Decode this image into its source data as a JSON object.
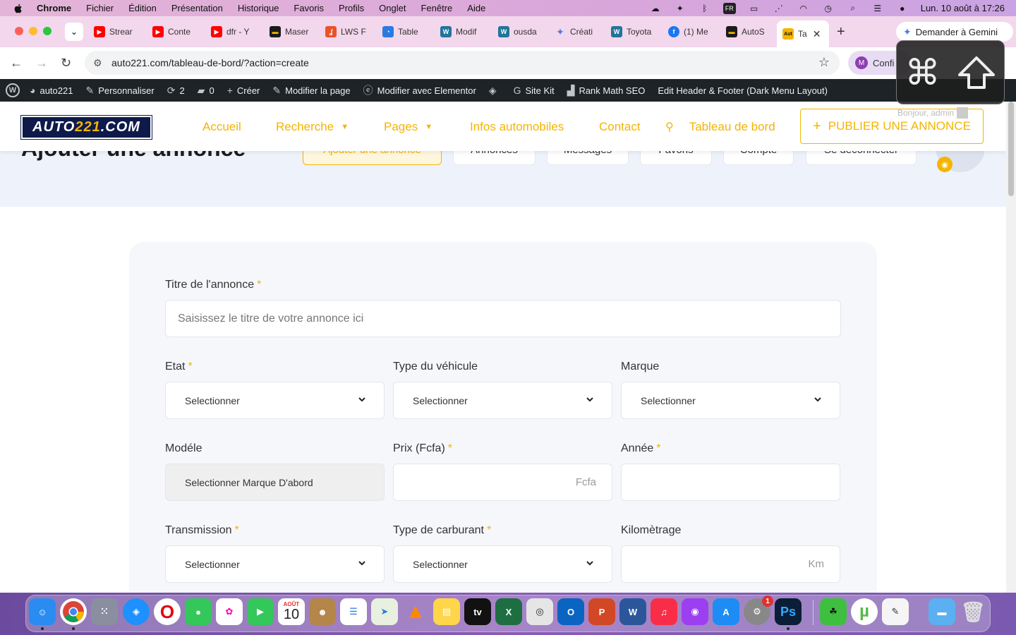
{
  "menubar": {
    "app": "Chrome",
    "items": [
      "Fichier",
      "Édition",
      "Présentation",
      "Historique",
      "Favoris",
      "Profils",
      "Onglet",
      "Fenêtre",
      "Aide"
    ],
    "input_source": "FR",
    "clock": "Lun. 10 août à 17:26"
  },
  "tabs": [
    {
      "label": "Strear",
      "favicon_color": "#ff0000"
    },
    {
      "label": "Conte",
      "favicon_color": "#ff0000"
    },
    {
      "label": "dfr - Y",
      "favicon_color": "#ff0000"
    },
    {
      "label": "Maser",
      "favicon_color": "#1b1b1b"
    },
    {
      "label": "LWS F",
      "favicon_color": "#e9532a"
    },
    {
      "label": "Table",
      "favicon_color": "#2a7ae2"
    },
    {
      "label": "Modif",
      "favicon_color": "#21759b"
    },
    {
      "label": "ousda",
      "favicon_color": "#21759b"
    },
    {
      "label": "Créati",
      "favicon_color": "#4a7cf0"
    },
    {
      "label": "Toyota",
      "favicon_color": "#21759b"
    },
    {
      "label": "(1) Me",
      "favicon_color": "#1877f2"
    },
    {
      "label": "AutoS",
      "favicon_color": "#1b1b1b"
    }
  ],
  "active_tab": {
    "label": "Ta",
    "favicon_text": "Aut"
  },
  "gemini_button": "Demander à Gemini",
  "address": {
    "url": "auto221.com/tableau-de-bord/?action=create"
  },
  "profile_button": {
    "initial": "M",
    "label": "Confi"
  },
  "wpbar": {
    "site": "auto221",
    "customize": "Personnaliser",
    "updates": "2",
    "comments": "0",
    "new": "Créer",
    "edit_page": "Modifier la page",
    "elementor": "Modifier avec Elementor",
    "site_kit": "Site Kit",
    "rank_math": "Rank Math SEO",
    "header_footer": "Edit Header & Footer (Dark Menu Layout)"
  },
  "header": {
    "logo_main": "AUTO",
    "logo_accent": "221",
    "logo_suffix": ".COM",
    "nav": [
      {
        "label": "Accueil",
        "dropdown": false
      },
      {
        "label": "Recherche",
        "dropdown": true
      },
      {
        "label": "Pages",
        "dropdown": true
      },
      {
        "label": "Infos automobiles",
        "dropdown": false
      },
      {
        "label": "Contact",
        "dropdown": false
      },
      {
        "label": "Tableau de bord",
        "dropdown": false
      }
    ],
    "publish_button": "PUBLIER UNE ANNONCE",
    "greeting": "Bonjour, admin"
  },
  "dashboard": {
    "title": "Ajouter une annonce",
    "tabs": [
      "Ajouter une annonce",
      "Annonces",
      "Messages",
      "Favoris",
      "Compte",
      "Se déconnecter"
    ]
  },
  "form": {
    "title_label": "Titre de l'annonce",
    "title_placeholder": "Saisissez le titre de votre annonce ici",
    "etat_label": "Etat",
    "etat_value": "Selectionner",
    "type_label": "Type du véhicule",
    "type_value": "Selectionner",
    "marque_label": "Marque",
    "marque_value": "Selectionner",
    "modele_label": "Modéle",
    "modele_value": "Selectionner Marque D'abord",
    "prix_label": "Prix (Fcfa)",
    "prix_suffix": "Fcfa",
    "annee_label": "Année",
    "transmission_label": "Transmission",
    "transmission_value": "Selectionner",
    "carburant_label": "Type de carburant",
    "carburant_value": "Selectionner",
    "km_label": "Kilomètrage",
    "km_suffix": "Km",
    "required_mark": "*"
  },
  "dock": {
    "calendar_month": "AOÛT",
    "calendar_day": "10",
    "settings_badge": "1",
    "photoshop_label": "Ps"
  },
  "colors": {
    "accent": "#f4b400",
    "brand_navy": "#0e1a4a",
    "wp_bar": "#1d2327"
  }
}
